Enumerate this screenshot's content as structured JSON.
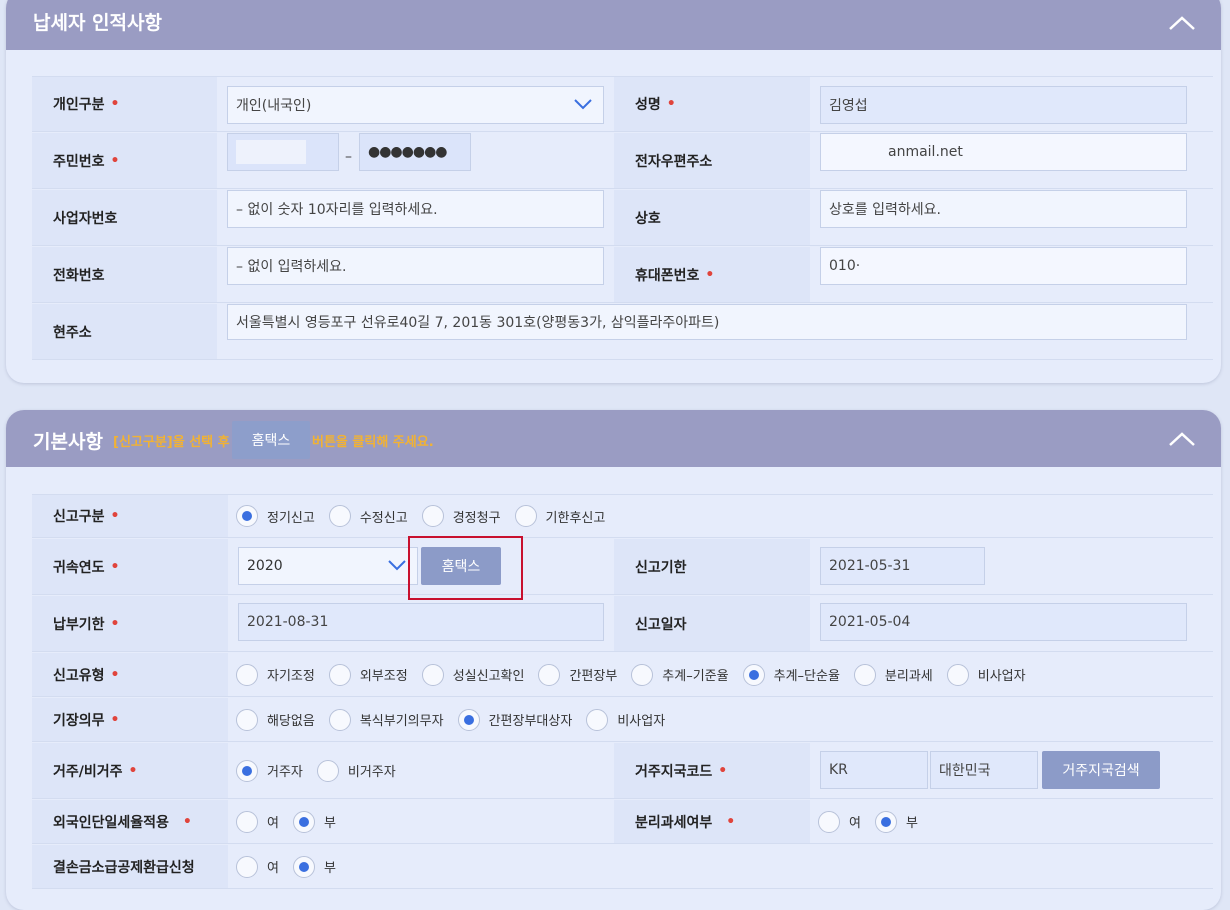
{
  "taxpayer": {
    "title": "납세자 인적사항",
    "labels": {
      "person_type": "개인구분",
      "name": "성명",
      "rrn": "주민번호",
      "email": "전자우편주소",
      "biz_no": "사업자번호",
      "company": "상호",
      "phone": "전화번호",
      "mobile": "휴대폰번호",
      "address": "현주소"
    },
    "required_mark": "•",
    "person_type_value": "개인(내국인)",
    "name_value": "김영섭",
    "rrn_dash": "–",
    "rrn_back": "●●●●●●●",
    "email_value": "anmail.net",
    "biz_no_placeholder": "– 없이 숫자 10자리를 입력하세요.",
    "company_placeholder": "상호를 입력하세요.",
    "phone_placeholder": "– 없이 입력하세요.",
    "mobile_value": "010·",
    "address_value": "서울특별시 영등포구 선유로40길 7, 201동 301호(양평동3가, 삼익플라주아파트)"
  },
  "basic": {
    "title": "기본사항",
    "hint_left": "[신고구분]을 선택 후",
    "hint_button": "홈택스",
    "hint_right": "버튼을 클릭해 주세요.",
    "labels": {
      "report_type": "신고구분",
      "year": "귀속연도",
      "deadline": "신고기한",
      "pay_deadline": "납부기한",
      "report_date": "신고일자",
      "report_kind": "신고유형",
      "bookkeeping": "기장의무",
      "residency": "거주/비거주",
      "country_code": "거주지국코드",
      "foreign_flat": "외국인단일세율적용",
      "separate_tax": "분리과세여부",
      "loss_refund": "결손금소급공제환급신청"
    },
    "report_type_options": [
      "정기신고",
      "수정신고",
      "경정청구",
      "기한후신고"
    ],
    "report_type_selected": 0,
    "year_value": "2020",
    "hometax_button": "홈택스",
    "deadline_value": "2021-05-31",
    "pay_deadline_value": "2021-08-31",
    "report_date_value": "2021-05-04",
    "report_kind_options": [
      "자기조정",
      "외부조정",
      "성실신고확인",
      "간편장부",
      "추계–기준율",
      "추계–단순율",
      "분리과세",
      "비사업자"
    ],
    "report_kind_selected": 5,
    "bookkeeping_options": [
      "해당없음",
      "복식부기의무자",
      "간편장부대상자",
      "비사업자"
    ],
    "bookkeeping_selected": 2,
    "residency_options": [
      "거주자",
      "비거주자"
    ],
    "residency_selected": 0,
    "country_code_value": "KR",
    "country_name_value": "대한민국",
    "country_search_button": "거주지국검색",
    "foreign_flat_options": [
      "여",
      "부"
    ],
    "foreign_flat_selected": 1,
    "separate_tax_options": [
      "여",
      "부"
    ],
    "separate_tax_selected": 1,
    "loss_refund_options": [
      "여",
      "부"
    ],
    "loss_refund_selected": 1
  },
  "colors": {
    "header": "#9a9cc3",
    "panel": "#e6ecfb",
    "button": "#8c9bc8",
    "radio_selected": "#3a6fe0",
    "required": "#e0443c",
    "hint": "#f2b233",
    "highlight": "#c8102e"
  }
}
